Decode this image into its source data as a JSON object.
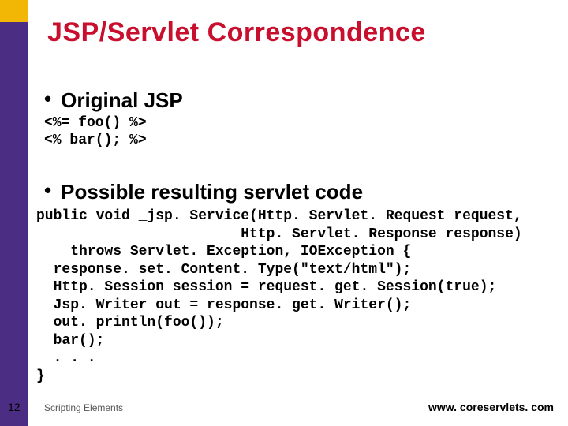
{
  "title": "JSP/Servlet Correspondence",
  "bullets": {
    "b1": {
      "label": "Original JSP"
    },
    "b2": {
      "label": "Possible resulting servlet code"
    }
  },
  "code": {
    "jsp": "<%= foo() %>\n<% bar(); %>",
    "servlet": "public void _jsp. Service(Http. Servlet. Request request,\n                        Http. Servlet. Response response)\n    throws Servlet. Exception, IOException {\n  response. set. Content. Type(\"text/html\");\n  Http. Session session = request. get. Session(true);\n  Jsp. Writer out = response. get. Writer();\n  out. println(foo());\n  bar();\n  . . .\n}"
  },
  "footer": {
    "slide_number": "12",
    "left": "Scripting Elements",
    "right": "www. coreservlets. com"
  }
}
